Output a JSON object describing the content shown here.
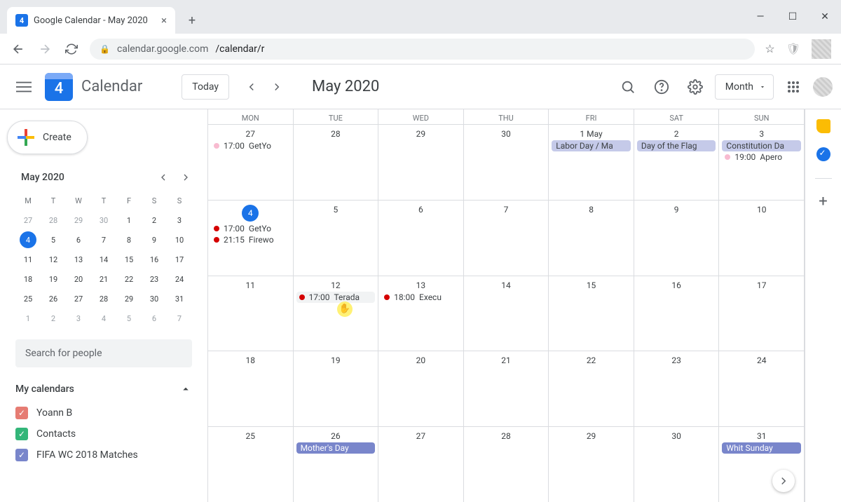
{
  "browser": {
    "tab_title": "Google Calendar - May 2020",
    "favicon_text": "4",
    "url_host": "calendar.google.com",
    "url_path": "/calendar/r"
  },
  "header": {
    "app_name": "Calendar",
    "logo_day": "4",
    "today_label": "Today",
    "current_label": "May 2020",
    "view_label": "Month"
  },
  "sidebar": {
    "create_label": "Create",
    "mini_month_label": "May 2020",
    "dow": [
      "M",
      "T",
      "W",
      "T",
      "F",
      "S",
      "S"
    ],
    "mini_days": [
      {
        "n": "27",
        "o": true
      },
      {
        "n": "28",
        "o": true
      },
      {
        "n": "29",
        "o": true
      },
      {
        "n": "30",
        "o": true
      },
      {
        "n": "1"
      },
      {
        "n": "2"
      },
      {
        "n": "3"
      },
      {
        "n": "4",
        "today": true
      },
      {
        "n": "5"
      },
      {
        "n": "6"
      },
      {
        "n": "7"
      },
      {
        "n": "8"
      },
      {
        "n": "9"
      },
      {
        "n": "10"
      },
      {
        "n": "11"
      },
      {
        "n": "12"
      },
      {
        "n": "13"
      },
      {
        "n": "14"
      },
      {
        "n": "15"
      },
      {
        "n": "16"
      },
      {
        "n": "17"
      },
      {
        "n": "18"
      },
      {
        "n": "19"
      },
      {
        "n": "20"
      },
      {
        "n": "21"
      },
      {
        "n": "22"
      },
      {
        "n": "23"
      },
      {
        "n": "24"
      },
      {
        "n": "25"
      },
      {
        "n": "26"
      },
      {
        "n": "27"
      },
      {
        "n": "28"
      },
      {
        "n": "29"
      },
      {
        "n": "30"
      },
      {
        "n": "31"
      },
      {
        "n": "1",
        "o": true
      },
      {
        "n": "2",
        "o": true
      },
      {
        "n": "3",
        "o": true
      },
      {
        "n": "4",
        "o": true
      },
      {
        "n": "5",
        "o": true
      },
      {
        "n": "6",
        "o": true
      },
      {
        "n": "7",
        "o": true
      }
    ],
    "search_placeholder": "Search for people",
    "my_calendars_label": "My calendars",
    "calendars": [
      {
        "name": "Yoann B",
        "color": "#e67c73"
      },
      {
        "name": "Contacts",
        "color": "#33b679"
      },
      {
        "name": "FIFA WC 2018 Matches",
        "color": "#7986cb"
      }
    ]
  },
  "grid": {
    "dow": [
      "MON",
      "TUE",
      "WED",
      "THU",
      "FRI",
      "SAT",
      "SUN"
    ],
    "weeks": [
      [
        {
          "num": "27",
          "events": [
            {
              "type": "dot",
              "color": "pink",
              "time": "17:00",
              "title": "GetYo"
            }
          ]
        },
        {
          "num": "28"
        },
        {
          "num": "29"
        },
        {
          "num": "30"
        },
        {
          "num": "1 May",
          "events": [
            {
              "type": "allday",
              "title": "Labor Day / Ma"
            }
          ]
        },
        {
          "num": "2",
          "events": [
            {
              "type": "allday",
              "title": "Day of the Flag"
            }
          ]
        },
        {
          "num": "3",
          "events": [
            {
              "type": "allday",
              "title": "Constitution Da"
            },
            {
              "type": "dot",
              "color": "pink",
              "time": "19:00",
              "title": "Apero"
            }
          ]
        }
      ],
      [
        {
          "num": "4",
          "today": true,
          "events": [
            {
              "type": "dot",
              "color": "red",
              "time": "17:00",
              "title": "GetYo"
            },
            {
              "type": "dot",
              "color": "red",
              "time": "21:15",
              "title": "Firewo"
            }
          ]
        },
        {
          "num": "5"
        },
        {
          "num": "6"
        },
        {
          "num": "7"
        },
        {
          "num": "8"
        },
        {
          "num": "9"
        },
        {
          "num": "10"
        }
      ],
      [
        {
          "num": "11"
        },
        {
          "num": "12",
          "events": [
            {
              "type": "dot",
              "color": "red",
              "time": "17:00",
              "title": "Terada",
              "hover": true
            }
          ]
        },
        {
          "num": "13",
          "events": [
            {
              "type": "dot",
              "color": "red",
              "time": "18:00",
              "title": "Execu"
            }
          ]
        },
        {
          "num": "14"
        },
        {
          "num": "15"
        },
        {
          "num": "16"
        },
        {
          "num": "17"
        }
      ],
      [
        {
          "num": "18"
        },
        {
          "num": "19"
        },
        {
          "num": "20"
        },
        {
          "num": "21"
        },
        {
          "num": "22"
        },
        {
          "num": "23"
        },
        {
          "num": "24"
        }
      ],
      [
        {
          "num": "25"
        },
        {
          "num": "26",
          "events": [
            {
              "type": "allday",
              "style": "blue",
              "title": "Mother's Day"
            }
          ]
        },
        {
          "num": "27"
        },
        {
          "num": "28"
        },
        {
          "num": "29"
        },
        {
          "num": "30"
        },
        {
          "num": "31",
          "events": [
            {
              "type": "allday",
              "style": "blue",
              "title": "Whit Sunday"
            }
          ]
        }
      ]
    ]
  }
}
